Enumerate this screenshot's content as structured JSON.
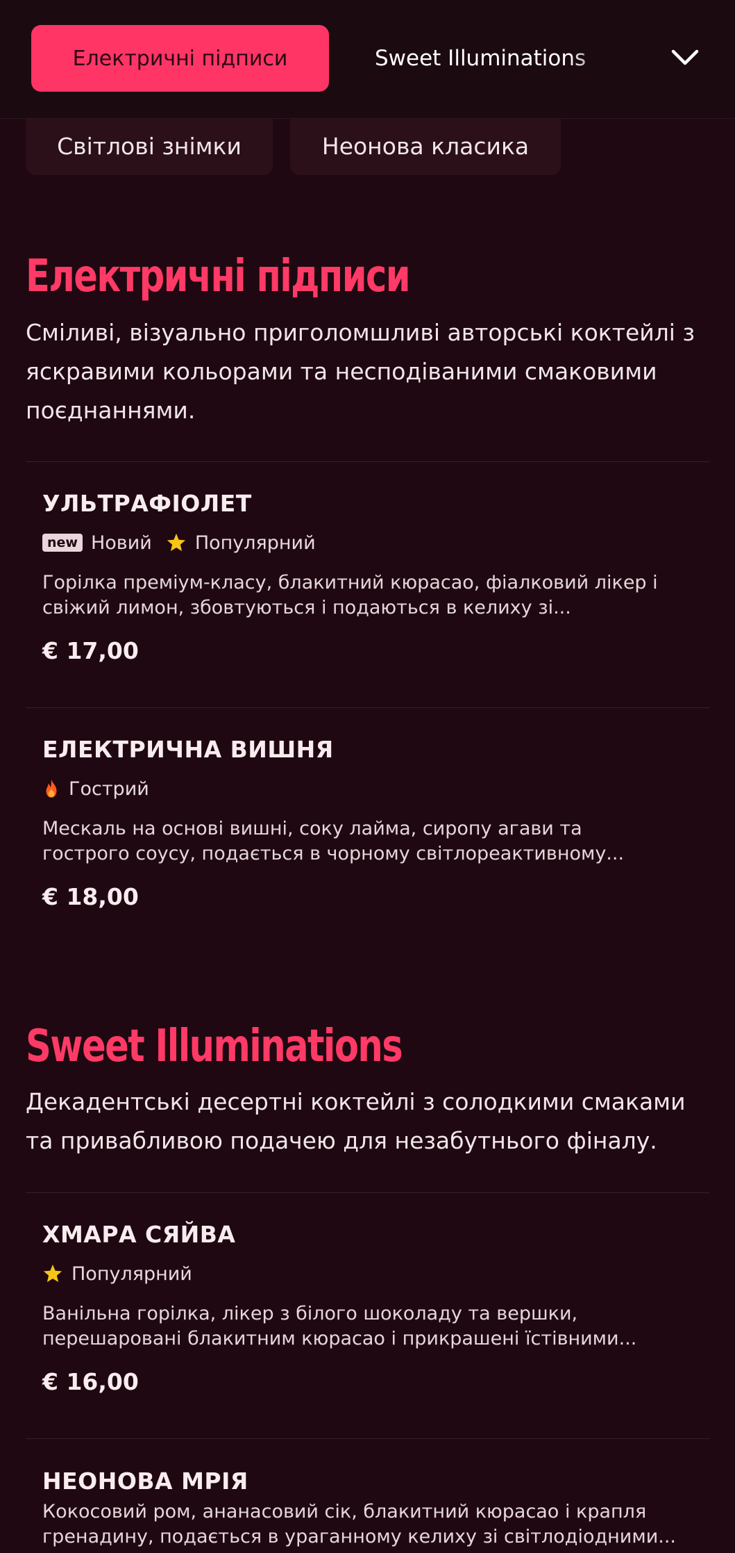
{
  "nav": {
    "active_tab": "Електричні підписи",
    "next_tab": "Sweet Illuminations",
    "dropdown_icon": "chevron-down-icon",
    "pills": [
      "Світлові знімки",
      "Неонова класика"
    ]
  },
  "sections": [
    {
      "title": "Електричні підписи",
      "description": "Сміливі, візуально приголомшливі авторські коктейлі з яскравими кольорами та несподіваними смаковими поєднаннями.",
      "items": [
        {
          "name": "УЛЬТРАФІОЛЕТ",
          "badges": [
            {
              "icon": "new-badge",
              "label": "new",
              "text": "Новий"
            },
            {
              "icon": "star-icon",
              "text": "Популярний"
            }
          ],
          "description_lines": [
            "Горілка преміум-класу, блакитний кюрасао, фіалковий лікер і",
            "свіжий лимон, збовтуються і подаються в келиху зі..."
          ],
          "price": "€ 17,00"
        },
        {
          "name": "ЕЛЕКТРИЧНА ВИШНЯ",
          "badges": [
            {
              "icon": "fire-icon",
              "text": "Гострий"
            }
          ],
          "description_lines": [
            "Мескаль на основі вишні, соку лайма, сиропу агави та",
            "гострого соусу, подається в чорному світлореактивному..."
          ],
          "price": "€ 18,00"
        }
      ]
    },
    {
      "title": "Sweet Illuminations",
      "description": "Декадентські десертні коктейлі з солодкими смаками та привабливою подачею для незабутнього фіналу.",
      "items": [
        {
          "name": "ХМАРА СЯЙВА",
          "badges": [
            {
              "icon": "star-icon",
              "text": "Популярний"
            }
          ],
          "description_lines": [
            "Ванільна горілка, лікер з білого шоколаду та вершки,",
            "перешаровані блакитним кюрасао і прикрашені їстівними..."
          ],
          "price": "€ 16,00"
        },
        {
          "name": "НЕОНОВА МРІЯ",
          "badges": [],
          "description_lines": [
            "Кокосовий ром, ананасовий сік, блакитний кюрасао і крапля",
            "гренадину, подається в ураганному келиху зі світлодіодними..."
          ]
        }
      ]
    }
  ],
  "colors": {
    "background": "#1f0811",
    "accent": "#ff3a66",
    "star": "#f5c518",
    "fire": "#ff5a1f"
  }
}
